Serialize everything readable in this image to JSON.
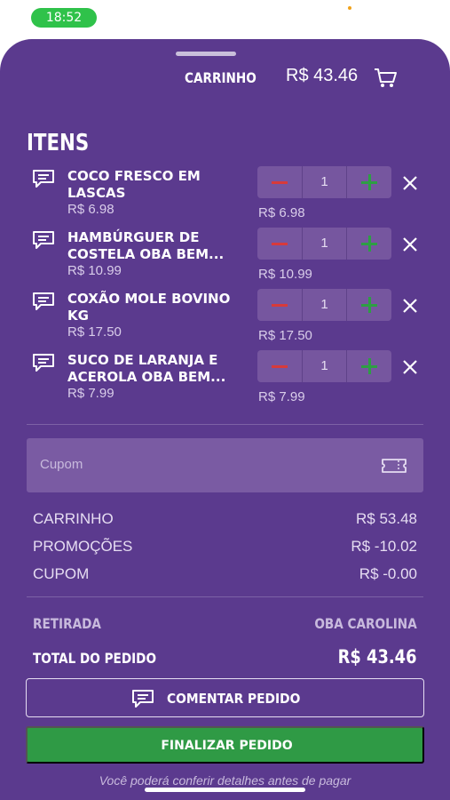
{
  "status_bar": {
    "time": "18:52"
  },
  "header": {
    "title": "CARRINHO",
    "total": "R$ 43.46"
  },
  "items_section": {
    "title": "ITENS"
  },
  "items": [
    {
      "name": "COCO FRESCO EM LASCAS",
      "unit_price": "R$ 6.98",
      "quantity": "1",
      "line_total": "R$ 6.98"
    },
    {
      "name": "HAMBÚRGUER DE COSTELA OBA BEM...",
      "unit_price": "R$ 10.99",
      "quantity": "1",
      "line_total": "R$ 10.99"
    },
    {
      "name": "COXÃO MOLE BOVINO KG",
      "unit_price": "R$ 17.50",
      "quantity": "1",
      "line_total": "R$ 17.50"
    },
    {
      "name": "SUCO DE LARANJA E ACEROLA OBA BEM...",
      "unit_price": "R$ 7.99",
      "quantity": "1",
      "line_total": "R$ 7.99"
    }
  ],
  "coupon": {
    "placeholder": "Cupom",
    "value": ""
  },
  "summary": [
    {
      "label": "CARRINHO",
      "value": "R$ 53.48"
    },
    {
      "label": "PROMOÇÕES",
      "value": "R$ -10.02"
    },
    {
      "label": "CUPOM",
      "value": "R$ -0.00"
    }
  ],
  "pickup": {
    "label": "RETIRADA",
    "value": "OBA CAROLINA"
  },
  "order_total": {
    "label": "TOTAL DO PEDIDO",
    "value": "R$ 43.46"
  },
  "buttons": {
    "comment": "COMENTAR PEDIDO",
    "finish": "FINALIZAR PEDIDO"
  },
  "footnote": "Você poderá conferir detalhes antes de pagar",
  "colors": {
    "sheet_background": "#5b3a8e",
    "finish_button": "#2f9a45",
    "decrement": "#d83a3a",
    "increment": "#2e9e44",
    "time_pill": "#2fc24a"
  }
}
